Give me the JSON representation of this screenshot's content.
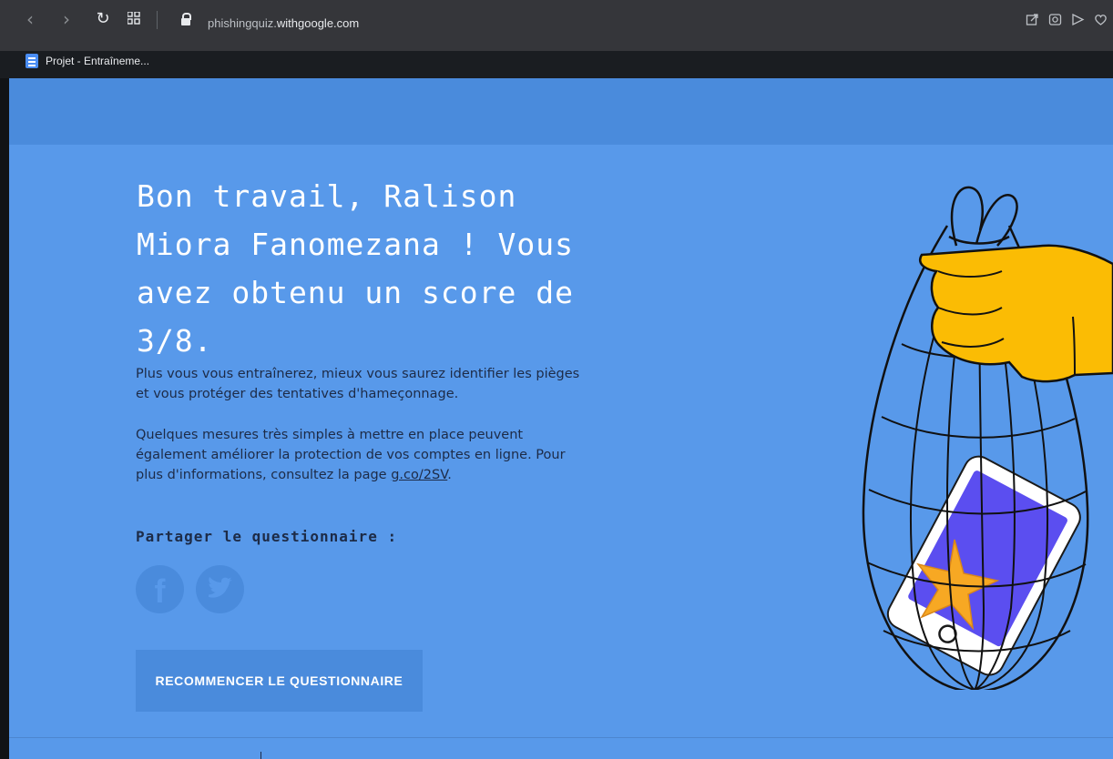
{
  "browser": {
    "url_prefix": "phishingquiz.",
    "url_domain": "withgoogle.com",
    "bookmark_label": "Projet - Entraîneme...",
    "icons": [
      "back-icon",
      "forward-icon",
      "reload-icon",
      "apps-icon",
      "lock-icon",
      "share-icon",
      "screenshot-icon",
      "send-icon",
      "heart-icon"
    ]
  },
  "result": {
    "title": "Bon travail, Ralison Miora Fanomezana ! Vous avez obtenu un score de 3/8.",
    "para1": "Plus vous vous entraînerez, mieux vous saurez identifier les pièges et vous protéger des tentatives d'hameçonnage.",
    "para2_text": "Quelques mesures très simples à mettre en place peuvent également améliorer la protection de vos comptes en ligne. Pour plus d'informations, consultez la page ",
    "para2_link": "g.co/2SV",
    "para2_end": "."
  },
  "share": {
    "label": "Partager le questionnaire :",
    "facebook_glyph": "f",
    "icons": [
      "facebook-icon",
      "twitter-icon"
    ]
  },
  "restart_label": "RECOMMENCER LE QUESTIONNAIRE",
  "colors": {
    "page_bg": "#5899ea",
    "header_bg": "#4a8bdc",
    "text_dark": "#1d2b47",
    "hand": "#fbbc04",
    "phone": "#5b4ef0"
  }
}
